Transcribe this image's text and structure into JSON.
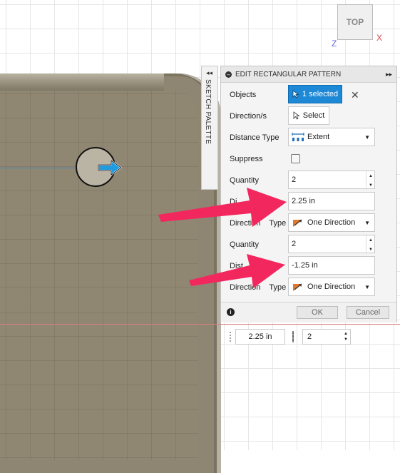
{
  "viewcube": {
    "label": "TOP",
    "axis_x": "X",
    "axis_z": "Z"
  },
  "sketch_palette": {
    "label": "SKETCH PALETTE",
    "collapse_glyph": "◂◂"
  },
  "dialog": {
    "title": "EDIT RECTANGULAR PATTERN",
    "expand_glyph": "▸▸",
    "rows": {
      "objects": {
        "label": "Objects",
        "button": "1 selected",
        "clear": "✕"
      },
      "direction": {
        "label": "Direction/s",
        "button": "Select"
      },
      "distance_type": {
        "label": "Distance Type",
        "value": "Extent"
      },
      "suppress": {
        "label": "Suppress",
        "checked": false
      },
      "quantity1": {
        "label": "Quantity",
        "value": "2"
      },
      "distance1": {
        "label": "Di",
        "value": "2.25 in"
      },
      "direction_type1": {
        "label": "Direction Type",
        "label_visible": "Direction    Type",
        "value": "One Direction"
      },
      "quantity2": {
        "label": "Quantity",
        "value": "2"
      },
      "distance2": {
        "label": "Dist",
        "value": "-1.25 in"
      },
      "direction_type2": {
        "label": "Direction Type",
        "label_visible": "Direction    Type",
        "value": "One Direction"
      }
    },
    "footer": {
      "ok": "OK",
      "cancel": "Cancel",
      "info": "i"
    }
  },
  "canvas_inputs": {
    "distance": "2.25 in",
    "quantity": "2"
  },
  "colors": {
    "accent": "#1d88d6",
    "annotation_arrow": "#f2275e",
    "body": "#8e8672"
  }
}
